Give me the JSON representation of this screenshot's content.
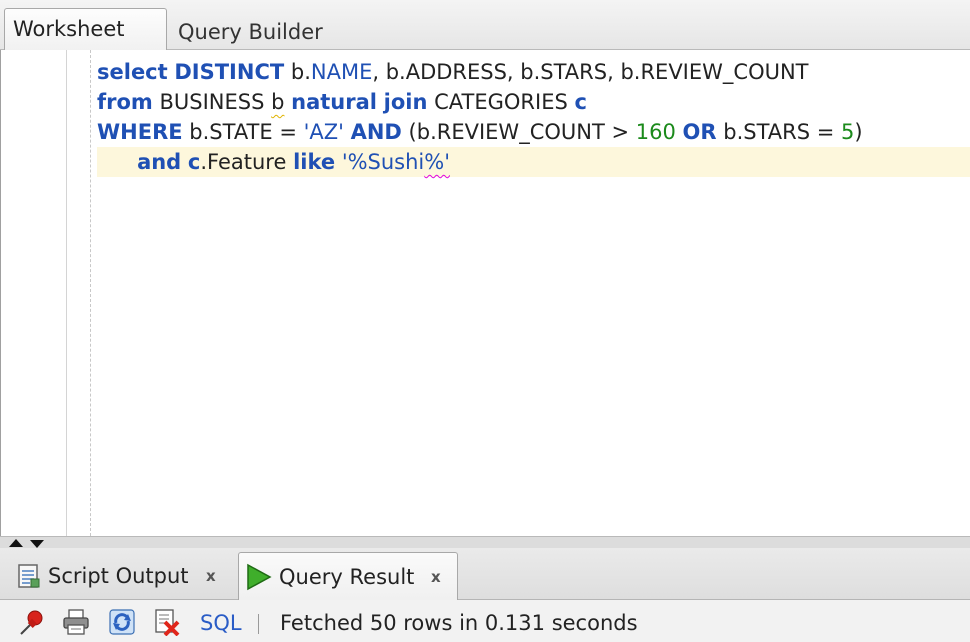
{
  "top_tabs": {
    "worksheet": "Worksheet",
    "query_builder": "Query Builder"
  },
  "editor": {
    "lines": [
      [
        "select",
        " ",
        "DISTINCT",
        " b.",
        "NAME",
        ", b.ADDRESS, b.STARS, b.REVIEW_COUNT"
      ],
      [
        "from",
        " BUSINESS ",
        "b",
        " ",
        "natural",
        " ",
        "join",
        " CATEGORIES ",
        "c"
      ],
      [
        "WHERE",
        " b.STATE = ",
        "'AZ'",
        " ",
        "AND",
        " (b.REVIEW_COUNT > ",
        "160",
        " ",
        "OR",
        " b.STARS = ",
        "5",
        ")"
      ],
      [
        "      ",
        "and",
        " ",
        "c",
        ".Feature ",
        "like",
        " ",
        "'%Sushi",
        "%'"
      ]
    ]
  },
  "bottom_tabs": {
    "script_output": "Script Output",
    "query_result": "Query Result",
    "close_glyph": "x"
  },
  "toolbar": {
    "sql_label": "SQL",
    "separator": "|",
    "status": "Fetched 50 rows in 0.131 seconds"
  },
  "icons": {
    "pin": "pin-icon",
    "print": "print-icon",
    "refresh": "refresh-icon",
    "clear": "clear-icon",
    "script": "script-output-icon",
    "run": "run-icon"
  },
  "colors": {
    "keyword": "#1f50b4",
    "number": "#1b8a1b",
    "current_line": "#fdf7dc"
  }
}
